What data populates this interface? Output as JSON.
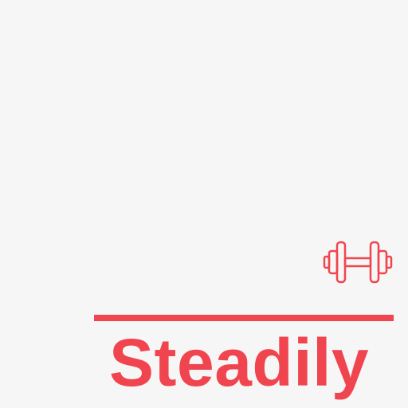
{
  "logo": {
    "brand_name": "Steadily",
    "icon": "dumbbell-icon",
    "accent_color": "#f0454f",
    "background_color": "#f6f6f6"
  }
}
